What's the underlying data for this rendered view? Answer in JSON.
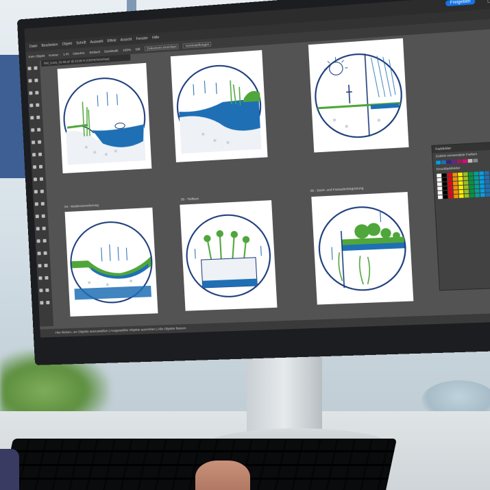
{
  "app": {
    "share_button": "Freigeben",
    "menu": [
      "Datei",
      "Bearbeiten",
      "Objekt",
      "Schrift",
      "Auswahl",
      "Effekt",
      "Ansicht",
      "Fenster",
      "Hilfe"
    ],
    "control_bar": [
      "Kein Objekt",
      "Kontur:",
      "1 Pt",
      "Gleichm.",
      "Einfach",
      "Deckkraft:",
      "100%",
      "Stil:",
      "Dokument einrichten",
      "Voreinstellungen"
    ],
    "document_tab": "RW_Icons_01-06.ai* @ 33,09 % (CMYK/Vorschau)",
    "status_bar": "Hier klicken, um Objekte auszuwählen   |   Ausgewählte Objekte ausrichten   |   Alle Objekte fixieren"
  },
  "artboards": [
    {
      "label": "",
      "theme": "pond"
    },
    {
      "label": "",
      "theme": "wetland"
    },
    {
      "label": "",
      "theme": "sun-rain"
    },
    {
      "label": "04 - Muldenversickerung",
      "theme": "swale"
    },
    {
      "label": "05 - Tiefbeet",
      "theme": "raised-bed"
    },
    {
      "label": "06 - Dach- und Fassadenbegrünung",
      "theme": "green-roof"
    }
  ],
  "swatch_panel": {
    "title": "Farbfelder",
    "recent": "Zuletzt verwendete Farben",
    "library": "Druckfarbfelder"
  },
  "colors": {
    "accent_blue": "#1f6fb5",
    "line_navy": "#1a3a7a",
    "leaf_green": "#4fa63a",
    "ui_dark": "#535353"
  }
}
